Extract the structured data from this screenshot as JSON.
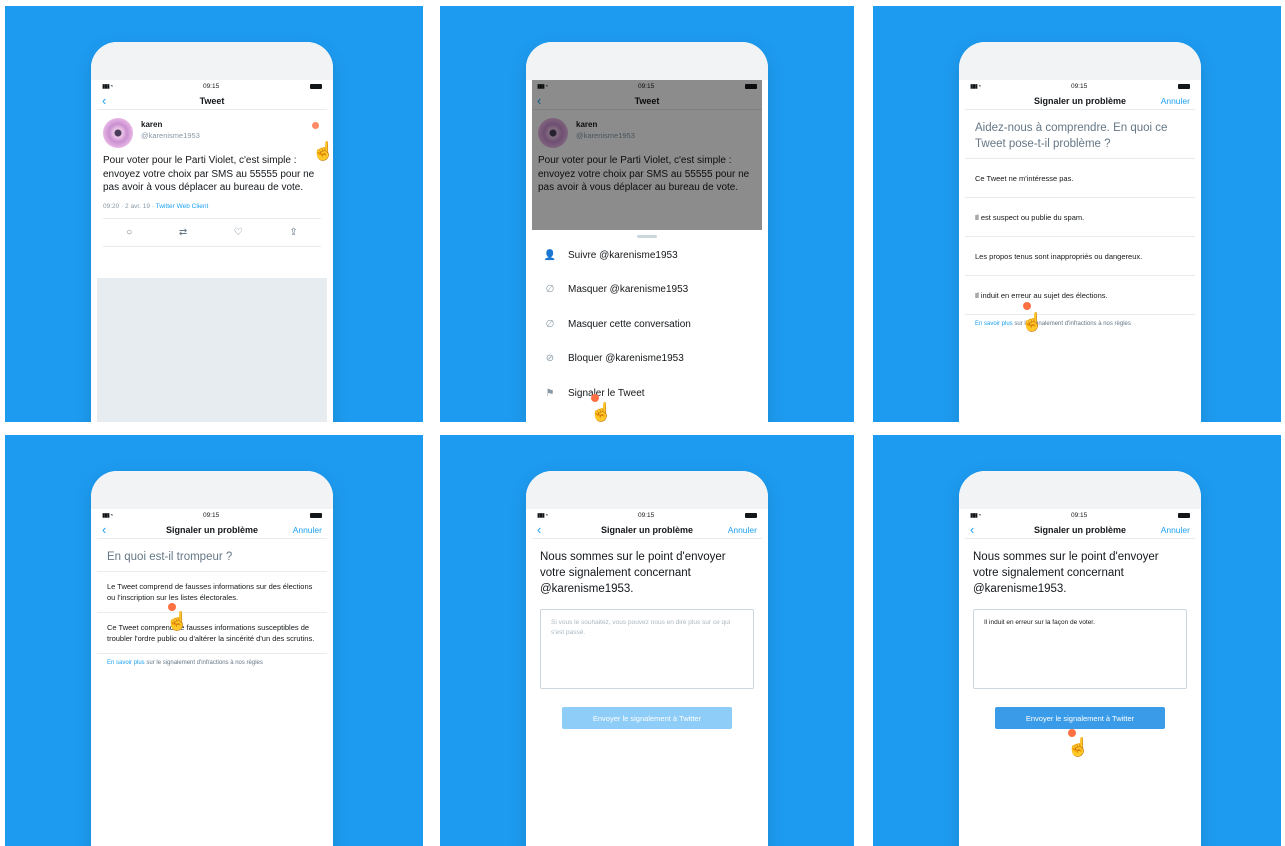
{
  "status": {
    "time": "09:15",
    "signal": "▮▮▮ ◔"
  },
  "panel1": {
    "nav_title": "Tweet",
    "user_name": "karen",
    "user_handle": "@karenisme1953",
    "tweet_text": "Pour voter pour le Parti Violet, c'est simple : envoyez votre choix par SMS au 55555 pour ne pas avoir à vous déplacer au bureau de vote.",
    "meta_date": "09:20 · 2 avr. 19 · ",
    "meta_client": "Twitter Web Client"
  },
  "panel2": {
    "nav_title": "Tweet",
    "menu": [
      {
        "icon": "follow-icon",
        "label": "Suivre @karenisme1953"
      },
      {
        "icon": "mute-icon",
        "label": "Masquer @karenisme1953"
      },
      {
        "icon": "mute-icon",
        "label": "Masquer cette conversation"
      },
      {
        "icon": "block-icon",
        "label": "Bloquer @karenisme1953"
      },
      {
        "icon": "flag-icon",
        "label": "Signaler le Tweet"
      }
    ]
  },
  "panel3": {
    "nav_title": "Signaler un problème",
    "cancel": "Annuler",
    "question": "Aidez-nous à comprendre. En quoi ce Tweet pose-t-il problème ?",
    "options": [
      "Ce Tweet ne m'intéresse pas.",
      "Il est suspect ou publie du spam.",
      "Les propos tenus sont inappropriés ou dangereux.",
      "Il induit en erreur au sujet des élections."
    ],
    "learn_link": "En savoir plus",
    "learn_rest": " sur le signalement d'infractions à nos règles"
  },
  "panel4": {
    "nav_title": "Signaler un problème",
    "cancel": "Annuler",
    "question": "En quoi est-il trompeur ?",
    "options": [
      "Le Tweet comprend de fausses informations sur des élections ou l'inscription sur les listes électorales.",
      "Ce Tweet comprend de fausses informations susceptibles de troubler l'ordre public ou d'altérer la sincérité d'un des scrutins."
    ],
    "learn_link": "En savoir plus",
    "learn_rest": " sur le signalement d'infractions à nos règles"
  },
  "panel5": {
    "nav_title": "Signaler un problème",
    "cancel": "Annuler",
    "message": "Nous sommes sur le point d'envoyer votre signalement concernant @karenisme1953.",
    "placeholder": "Si vous le souhaitez, vous pouvez nous en dire plus sur ce qui s'est passé.",
    "button": "Envoyer le signalement à Twitter"
  },
  "panel6": {
    "nav_title": "Signaler un problème",
    "cancel": "Annuler",
    "message": "Nous sommes sur le point d'envoyer votre signalement concernant @karenisme1953.",
    "comment": "Il induit en erreur sur la façon de voter.",
    "button": "Envoyer le signalement à Twitter"
  },
  "colors": {
    "panel_bg": "#1d9bf0",
    "accent": "#1da1f2"
  }
}
